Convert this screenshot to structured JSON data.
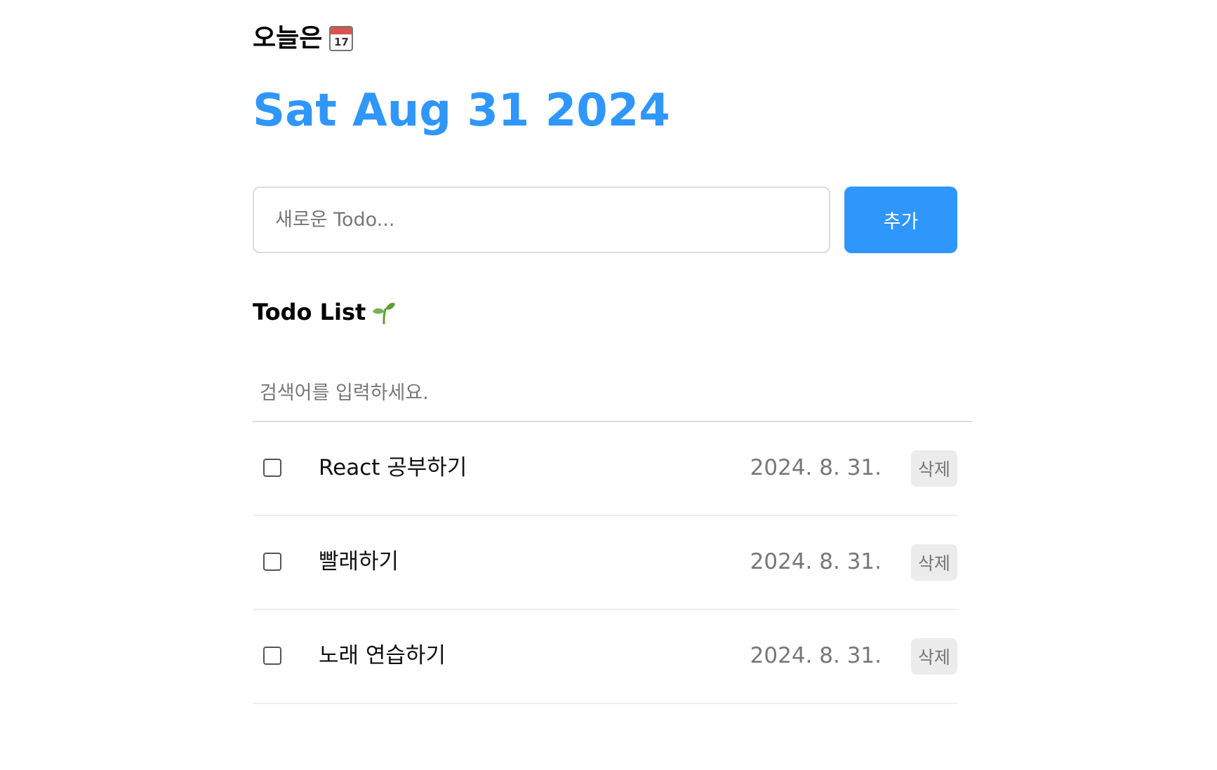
{
  "header": {
    "subtitle": "오늘은",
    "calendar_icon_day": "17",
    "date": "Sat Aug 31 2024"
  },
  "editor": {
    "placeholder": "새로운 Todo...",
    "add_label": "추가"
  },
  "list": {
    "title": "Todo List",
    "search_placeholder": "검색어를 입력하세요.",
    "items": [
      {
        "content": "React 공부하기",
        "date": "2024. 8. 31.",
        "delete_label": "삭제",
        "checked": false
      },
      {
        "content": "빨래하기",
        "date": "2024. 8. 31.",
        "delete_label": "삭제",
        "checked": false
      },
      {
        "content": "노래 연습하기",
        "date": "2024. 8. 31.",
        "delete_label": "삭제",
        "checked": false
      }
    ]
  },
  "colors": {
    "accent": "#2f96fb",
    "muted_text": "#777777",
    "delete_bg": "#ececec",
    "divider": "#eeeeee"
  },
  "icons": {
    "calendar": "calendar-icon",
    "sprout": "sprout-icon"
  }
}
